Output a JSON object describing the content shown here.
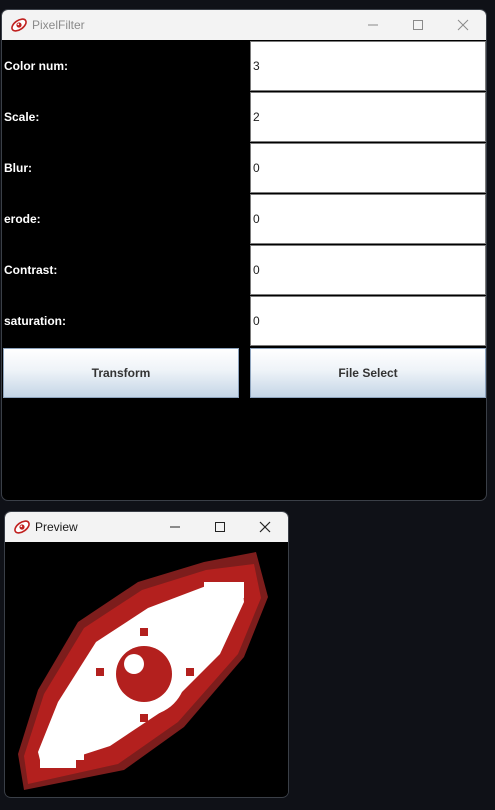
{
  "main_window": {
    "title": "PixelFilter",
    "fields": [
      {
        "label": "Color num:",
        "value": "3"
      },
      {
        "label": "Scale:",
        "value": "2"
      },
      {
        "label": "Blur:",
        "value": "0"
      },
      {
        "label": "erode:",
        "value": "0"
      },
      {
        "label": "Contrast:",
        "value": "0"
      },
      {
        "label": "saturation:",
        "value": "0"
      }
    ],
    "buttons": {
      "transform_label": "Transform",
      "file_select_label": "File Select"
    }
  },
  "preview_window": {
    "title": "Preview",
    "image": {
      "subject": "pixelated stylized eye",
      "palette": {
        "background": "#000000",
        "red": "#b3201e",
        "dark_red": "#7d1d1c",
        "white": "#ffffff"
      }
    }
  },
  "icons": {
    "app_icon": "red-eye-app-icon",
    "minimize": "minimize-icon",
    "maximize": "maximize-icon",
    "close": "close-icon"
  }
}
